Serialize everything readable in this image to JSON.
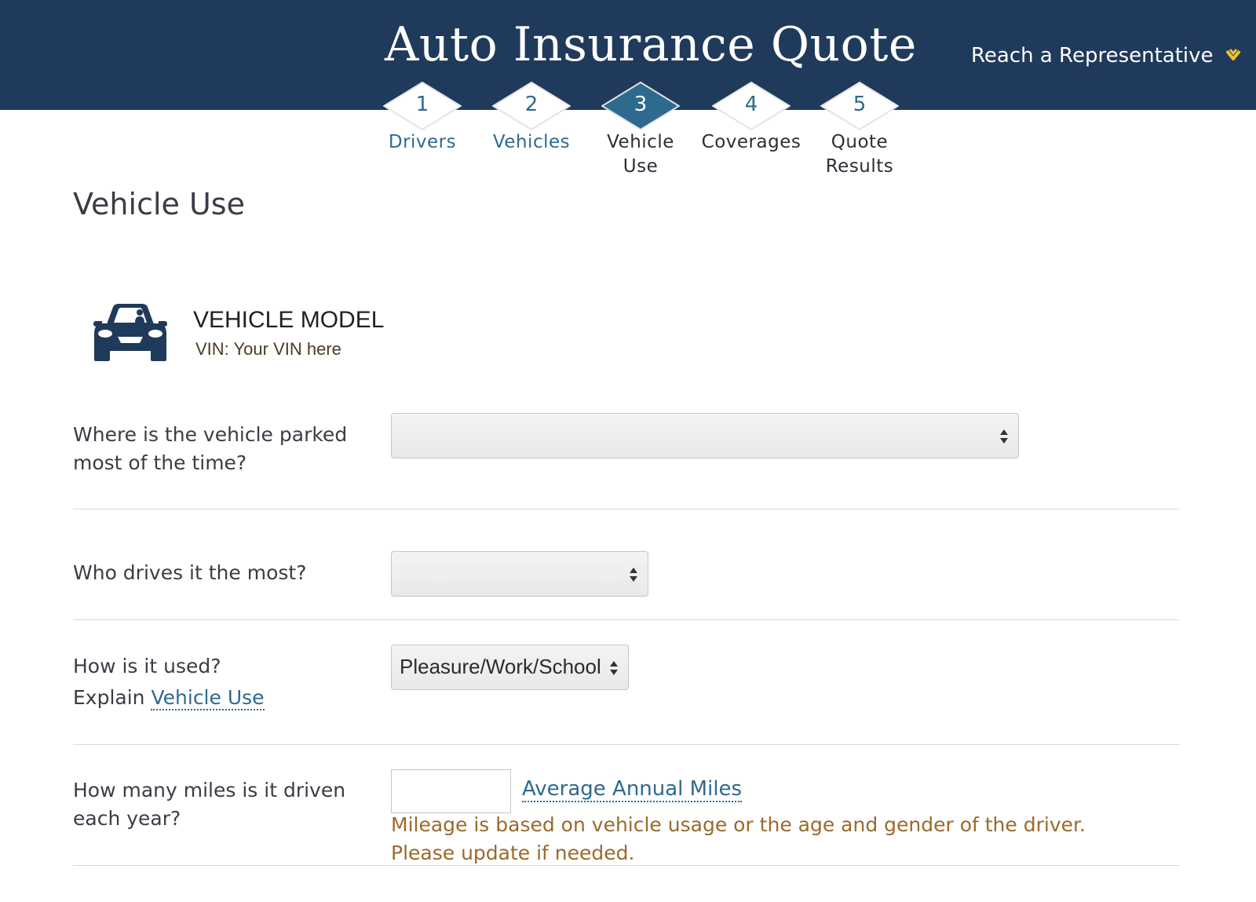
{
  "header": {
    "title": "Auto Insurance Quote",
    "rep_link": "Reach a Representative",
    "rep_icon": "chevron-down-icon",
    "background": "#1f3a5a",
    "accent": "#f1c232"
  },
  "steps": [
    {
      "num": "1",
      "label": "Drivers",
      "state": "completed"
    },
    {
      "num": "2",
      "label": "Vehicles",
      "state": "completed"
    },
    {
      "num": "3",
      "label": "Vehicle Use",
      "state": "active"
    },
    {
      "num": "4",
      "label": "Coverages",
      "state": "upcoming"
    },
    {
      "num": "5",
      "label": "Quote Results",
      "state": "upcoming"
    }
  ],
  "page": {
    "title": "Vehicle Use"
  },
  "vehicle": {
    "icon": "car-icon",
    "model": "VEHICLE MODEL",
    "vin": "VIN: Your VIN here"
  },
  "questions": {
    "parked": {
      "label": "Where is the vehicle parked most of the time?",
      "value": ""
    },
    "driver": {
      "label": "Who drives it the most?",
      "value": ""
    },
    "usage": {
      "label": "How is it used?",
      "explain_prefix": "Explain",
      "explain_link": "Vehicle Use",
      "value": "Pleasure/Work/School"
    },
    "miles": {
      "label": "How many miles is it driven each year?",
      "value": "",
      "link": "Average Annual Miles",
      "note": "Mileage is based on vehicle usage or the age and gender of the driver. Please update if needed."
    }
  },
  "colors": {
    "link": "#2e6a8e",
    "active_step": "#2e6a8e",
    "note": "#9a6a2c"
  }
}
